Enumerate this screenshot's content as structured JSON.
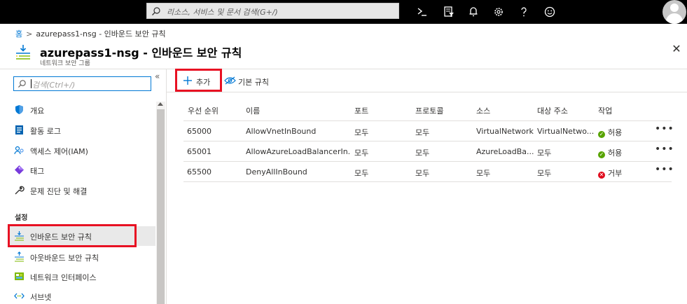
{
  "topbar": {
    "search_placeholder": "리소스, 서비스 및 문서 검색(G+/)",
    "icons": [
      "cloud-shell-icon",
      "directory-filter-icon",
      "notifications-icon",
      "settings-icon",
      "help-icon",
      "feedback-icon"
    ]
  },
  "breadcrumb": {
    "home": "홈",
    "current": "azurepass1-nsg - 인바운드 보안 규칙"
  },
  "header": {
    "title": "azurepass1-nsg - 인바운드 보안 규칙",
    "subtitle": "네트워크 보안 그룹"
  },
  "sidebar": {
    "search_placeholder": "검색(Ctrl+/)",
    "items": [
      {
        "label": "개요",
        "icon": "shield-icon"
      },
      {
        "label": "활동 로그",
        "icon": "activity-log-icon"
      },
      {
        "label": "액세스 제어(IAM)",
        "icon": "iam-icon"
      },
      {
        "label": "태그",
        "icon": "tag-icon"
      },
      {
        "label": "문제 진단 및 해결",
        "icon": "wrench-icon"
      }
    ],
    "section_label": "설정",
    "settings_items": [
      {
        "label": "인바운드 보안 규칙",
        "icon": "inbound-rules-icon",
        "active": true
      },
      {
        "label": "아웃바운드 보안 규칙",
        "icon": "outbound-rules-icon"
      },
      {
        "label": "네트워크 인터페이스",
        "icon": "network-interface-icon"
      },
      {
        "label": "서브넷",
        "icon": "subnet-icon"
      }
    ]
  },
  "toolbar": {
    "add_label": "추가",
    "default_rules_label": "기본 규칙"
  },
  "table": {
    "headers": [
      "우선 순위",
      "이름",
      "포트",
      "프로토콜",
      "소스",
      "대상 주소",
      "작업"
    ],
    "rows": [
      {
        "priority": "65000",
        "name": "AllowVnetInBound",
        "port": "모두",
        "protocol": "모두",
        "source": "VirtualNetwork",
        "destination": "VirtualNetwo...",
        "action": "허용",
        "status": "allow"
      },
      {
        "priority": "65001",
        "name": "AllowAzureLoadBalancerIn...",
        "port": "모두",
        "protocol": "모두",
        "source": "AzureLoadBa...",
        "destination": "모두",
        "action": "허용",
        "status": "allow"
      },
      {
        "priority": "65500",
        "name": "DenyAllInBound",
        "port": "모두",
        "protocol": "모두",
        "source": "모두",
        "destination": "모두",
        "action": "거부",
        "status": "deny"
      }
    ]
  },
  "colors": {
    "accent": "#0078d4",
    "highlight": "#e81123",
    "allow": "#57a300",
    "deny": "#e00b1c"
  }
}
